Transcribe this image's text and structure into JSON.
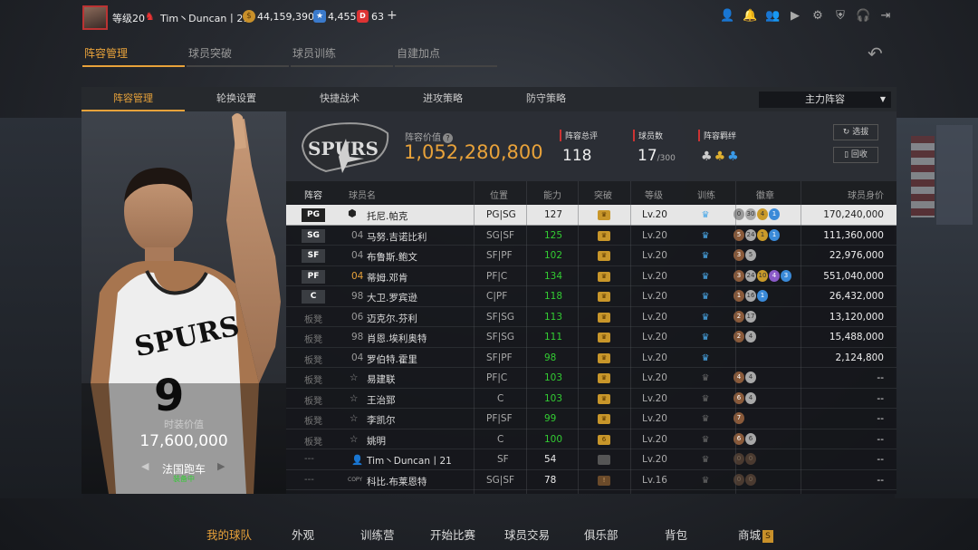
{
  "topbar": {
    "level": "等级20",
    "username": "Tim丶Duncan丨21",
    "coins": "44,159,390",
    "stars": "4,455",
    "d_points": "63",
    "plus": "+"
  },
  "main_tabs": [
    "阵容管理",
    "球员突破",
    "球员训练",
    "自建加点"
  ],
  "sub_tabs": [
    "阵容管理",
    "轮换设置",
    "快捷战术",
    "进攻策略",
    "防守策略"
  ],
  "lineup_dropdown": "主力阵容",
  "player_card": {
    "caption": "时装价值",
    "value": "17,600,000",
    "car": "法国跑车",
    "status": "装备中",
    "jersey_number": "9"
  },
  "summary": {
    "team_logo_text": "SPURS",
    "value_label": "阵容价值",
    "value": "1,052,280,800",
    "overall_label": "阵容总评",
    "overall": "118",
    "count_label": "球员数",
    "count": "17",
    "count_max": "/300",
    "bond_label": "阵容羁绊",
    "select_button": "选拔",
    "recycle_button": "回收"
  },
  "table": {
    "headers": [
      "阵容",
      "球员名",
      "位置",
      "能力",
      "突破",
      "等级",
      "训练",
      "徽章",
      "球员身价"
    ],
    "rows": [
      {
        "slot": "PG",
        "starter": true,
        "num": "",
        "name": "托尼.帕克",
        "pos": "PG|SG",
        "rating": "127",
        "rating_style": "white",
        "brk": "gold",
        "level": "Lv.20",
        "train": "blue",
        "badges": [
          {
            "t": "0",
            "c": "gray"
          },
          {
            "t": "30",
            "c": "silver"
          },
          {
            "t": "4",
            "c": "gold"
          },
          {
            "t": "1",
            "c": "blue"
          }
        ],
        "price": "170,240,000",
        "selected": true
      },
      {
        "slot": "SG",
        "starter": true,
        "num": "04",
        "name": "马努.吉诺比利",
        "pos": "SG|SF",
        "rating": "125",
        "rating_style": "green",
        "brk": "gold",
        "level": "Lv.20",
        "train": "blue",
        "badges": [
          {
            "t": "5",
            "c": "bronze"
          },
          {
            "t": "24",
            "c": "silver"
          },
          {
            "t": "1",
            "c": "gold"
          },
          {
            "t": "1",
            "c": "blue"
          }
        ],
        "price": "111,360,000"
      },
      {
        "slot": "SF",
        "starter": true,
        "num": "04",
        "name": "布鲁斯.鲍文",
        "pos": "SF|PF",
        "rating": "102",
        "rating_style": "green",
        "brk": "gold",
        "level": "Lv.20",
        "train": "blue",
        "badges": [
          {
            "t": "3",
            "c": "bronze"
          },
          {
            "t": "5",
            "c": "silver"
          }
        ],
        "price": "22,976,000"
      },
      {
        "slot": "PF",
        "starter": true,
        "num": "04",
        "num_style": "yellow",
        "name": "蒂姆.邓肯",
        "pos": "PF|C",
        "rating": "134",
        "rating_style": "green",
        "brk": "gold",
        "level": "Lv.20",
        "train": "blue",
        "badges": [
          {
            "t": "3",
            "c": "bronze"
          },
          {
            "t": "24",
            "c": "silver"
          },
          {
            "t": "10",
            "c": "gold"
          },
          {
            "t": "4",
            "c": "purple"
          },
          {
            "t": "3",
            "c": "blue"
          }
        ],
        "price": "551,040,000"
      },
      {
        "slot": "C",
        "starter": true,
        "num": "98",
        "name": "大卫.罗宾逊",
        "pos": "C|PF",
        "rating": "118",
        "rating_style": "green",
        "brk": "gold",
        "level": "Lv.20",
        "train": "blue",
        "badges": [
          {
            "t": "1",
            "c": "bronze"
          },
          {
            "t": "16",
            "c": "silver"
          },
          {
            "t": "1",
            "c": "blue"
          }
        ],
        "price": "26,432,000"
      },
      {
        "slot": "板凳",
        "starter": false,
        "num": "06",
        "name": "迈克尔.芬利",
        "pos": "SF|SG",
        "rating": "113",
        "rating_style": "green",
        "brk": "gold",
        "level": "Lv.20",
        "train": "blue",
        "badges": [
          {
            "t": "2",
            "c": "bronze"
          },
          {
            "t": "17",
            "c": "silver"
          }
        ],
        "price": "13,120,000"
      },
      {
        "slot": "板凳",
        "starter": false,
        "num": "98",
        "name": "肖恩.埃利奥特",
        "pos": "SF|SG",
        "rating": "111",
        "rating_style": "green",
        "brk": "gold",
        "level": "Lv.20",
        "train": "blue",
        "badges": [
          {
            "t": "2",
            "c": "bronze"
          },
          {
            "t": "4",
            "c": "silver"
          }
        ],
        "price": "15,488,000"
      },
      {
        "slot": "板凳",
        "starter": false,
        "num": "04",
        "name": "罗伯特.霍里",
        "pos": "SF|PF",
        "rating": "98",
        "rating_style": "green",
        "brk": "gold",
        "level": "Lv.20",
        "train": "blue",
        "badges": [],
        "price": "2,124,800"
      },
      {
        "slot": "板凳",
        "starter": false,
        "num": "",
        "name": "易建联",
        "pos": "PF|C",
        "rating": "103",
        "rating_style": "green",
        "brk": "gold",
        "level": "Lv.20",
        "train": "gray",
        "badges": [
          {
            "t": "4",
            "c": "bronze"
          },
          {
            "t": "4",
            "c": "silver"
          }
        ],
        "price": "--"
      },
      {
        "slot": "板凳",
        "starter": false,
        "num": "",
        "name": "王治郅",
        "pos": "C",
        "rating": "103",
        "rating_style": "green",
        "brk": "gold",
        "level": "Lv.20",
        "train": "gray",
        "badges": [
          {
            "t": "6",
            "c": "bronze"
          },
          {
            "t": "4",
            "c": "silver"
          }
        ],
        "price": "--"
      },
      {
        "slot": "板凳",
        "starter": false,
        "num": "",
        "name": "李凯尔",
        "pos": "PF|SF",
        "rating": "99",
        "rating_style": "green",
        "brk": "gold",
        "level": "Lv.20",
        "train": "gray",
        "badges": [
          {
            "t": "7",
            "c": "bronze"
          }
        ],
        "price": "--"
      },
      {
        "slot": "板凳",
        "starter": false,
        "num": "",
        "name": "姚明",
        "pos": "C",
        "rating": "100",
        "rating_style": "green",
        "brk": "gold6",
        "level": "Lv.20",
        "train": "gray",
        "badges": [
          {
            "t": "6",
            "c": "bronze"
          },
          {
            "t": "6",
            "c": "silver"
          }
        ],
        "price": "--"
      },
      {
        "slot": "---",
        "starter": false,
        "num": "",
        "name": "Tim丶Duncan丨21",
        "pos": "SF",
        "rating": "54",
        "rating_style": "white",
        "brk": "grayb",
        "level": "Lv.20",
        "train": "gray",
        "badges": [
          {
            "t": "0",
            "c": "dark"
          },
          {
            "t": "0",
            "c": "dark"
          }
        ],
        "price": "--"
      },
      {
        "slot": "---",
        "starter": false,
        "num": "COPY",
        "name": "科比.布莱恩特",
        "pos": "SG|SF",
        "rating": "78",
        "rating_style": "white",
        "brk": "dark",
        "level": "Lv.16",
        "train": "gray",
        "badges": [
          {
            "t": "0",
            "c": "dark"
          },
          {
            "t": "0",
            "c": "dark"
          }
        ],
        "price": "--"
      }
    ]
  },
  "bottom_nav": [
    "我的球队",
    "外观",
    "训练营",
    "开始比赛",
    "球员交易",
    "俱乐部",
    "背包",
    "商城"
  ],
  "shop_badge": "S",
  "colors": {
    "accent": "#e8a23a",
    "green": "#33cc33",
    "red": "#cc3333"
  }
}
